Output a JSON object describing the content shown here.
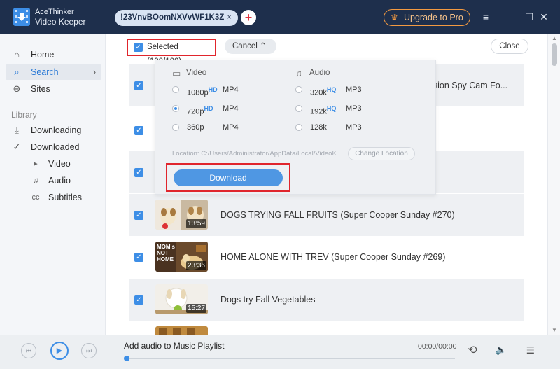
{
  "app": {
    "name_line1": "AceThinker",
    "name_line2": "Video Keeper"
  },
  "tab": {
    "url": "!23VnvBOomNXVvWF1K3Z",
    "close_glyph": "×",
    "add_glyph": "+"
  },
  "header": {
    "upgrade_label": "Upgrade to Pro",
    "menu_glyph": "≡",
    "minimize_glyph": "—",
    "maximize_glyph": "☐",
    "close_glyph": "✕"
  },
  "sidebar": {
    "items": [
      {
        "label": "Home",
        "icon": "home-icon",
        "glyph": "⌂"
      },
      {
        "label": "Search",
        "icon": "search-icon",
        "glyph": "⌕",
        "chevron": "›"
      },
      {
        "label": "Sites",
        "icon": "sites-icon",
        "glyph": "⊖"
      }
    ],
    "library_label": "Library",
    "library_items": [
      {
        "label": "Downloading",
        "icon": "download-arrow-icon",
        "glyph": "⤓"
      },
      {
        "label": "Downloaded",
        "icon": "check-circle-icon",
        "glyph": "✓"
      }
    ],
    "sub_items": [
      {
        "label": "Video",
        "icon": "play-circle-icon",
        "glyph": "▸"
      },
      {
        "label": "Audio",
        "icon": "music-note-icon",
        "glyph": "♫"
      },
      {
        "label": "Subtitles",
        "icon": "cc-icon",
        "glyph": "cc"
      }
    ]
  },
  "toolbar": {
    "selected_label": "Selected (100/100)",
    "cancel_label": "Cancel",
    "cancel_chevron": "⌃",
    "close_label": "Close"
  },
  "check_glyph": "✓",
  "videos": [
    {
      "title": "t Vision Spy Cam Fo..."
    },
    {
      "title": ""
    },
    {
      "title": ""
    },
    {
      "title": "DOGS TRYING FALL FRUITS (Super Cooper Sunday #270)",
      "duration": "13:59"
    },
    {
      "title": "HOME ALONE WITH TREV (Super Cooper Sunday #269)",
      "duration": "23:36",
      "thumb_text": "MOM's NOT HOME"
    },
    {
      "title": "Dogs try Fall Vegetables",
      "duration": "15:27"
    }
  ],
  "panel": {
    "video_header": "Video",
    "audio_header": "Audio",
    "video_options": [
      {
        "quality": "1080p",
        "badge": "HD",
        "format": "MP4",
        "selected": false
      },
      {
        "quality": "720p",
        "badge": "HD",
        "format": "MP4",
        "selected": true
      },
      {
        "quality": "360p",
        "badge": "",
        "format": "MP4",
        "selected": false
      }
    ],
    "audio_options": [
      {
        "quality": "320k",
        "badge": "HQ",
        "format": "MP3",
        "selected": false
      },
      {
        "quality": "192k",
        "badge": "HQ",
        "format": "MP3",
        "selected": false
      },
      {
        "quality": "128k",
        "badge": "",
        "format": "MP3",
        "selected": false
      }
    ],
    "location_text": "Location: C:/Users/Administrator/AppData/Local/VideoK...",
    "change_location_label": "Change Location",
    "download_label": "Download"
  },
  "player": {
    "track_title": "Add audio to Music Playlist",
    "time": "00:00/00:00",
    "progress": 0,
    "prev_glyph": "⏮",
    "play_glyph": "▶",
    "next_glyph": "⏭",
    "repeat_glyph": "⟲",
    "volume_glyph": "🔈",
    "playlist_glyph": "≣"
  },
  "colors": {
    "accent": "#3d8ee6",
    "highlight_border": "#e0252c",
    "titlebar": "#1e2f4c",
    "upgrade": "#f39a41"
  }
}
